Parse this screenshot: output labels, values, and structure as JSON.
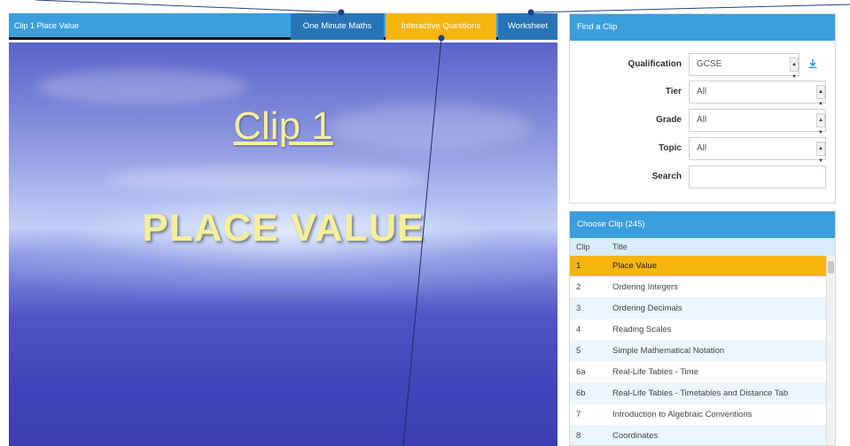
{
  "viewer": {
    "title": "Clip 1 Place Value",
    "tabs": {
      "one_minute_maths": "One Minute Maths",
      "interactive_questions": "Interactive Questions",
      "worksheet": "Worksheet"
    },
    "slide": {
      "heading": "Clip 1",
      "subject": "PLACE VALUE"
    }
  },
  "find_clip": {
    "header": "Find a Clip",
    "qualification": {
      "label": "Qualification",
      "value": "GCSE"
    },
    "tier": {
      "label": "Tier",
      "value": "All"
    },
    "grade": {
      "label": "Grade",
      "value": "All"
    },
    "topic": {
      "label": "Topic",
      "value": "All"
    },
    "search": {
      "label": "Search",
      "value": ""
    }
  },
  "choose_clip": {
    "header": "Choose Clip (245)",
    "columns": {
      "clip": "Clip",
      "title": "Title"
    },
    "rows": [
      {
        "clip": "1",
        "title": "Place Value"
      },
      {
        "clip": "2",
        "title": "Ordering Integers"
      },
      {
        "clip": "3",
        "title": "Ordering Decimals"
      },
      {
        "clip": "4",
        "title": "Reading Scales"
      },
      {
        "clip": "5",
        "title": "Simple Mathematical Notation"
      },
      {
        "clip": "6a",
        "title": "Real-Life Tables - Time"
      },
      {
        "clip": "6b",
        "title": "Real-Life Tables - Timetables and Distance Tab"
      },
      {
        "clip": "7",
        "title": "Introduction to Algebraic Conventions"
      },
      {
        "clip": "8",
        "title": "Coordinates"
      }
    ]
  },
  "colors": {
    "header_blue": "#3a9fdc",
    "tab_dark_blue": "#2874b8",
    "highlight_yellow": "#f7b50f",
    "slide_text": "#f6ef9a"
  }
}
